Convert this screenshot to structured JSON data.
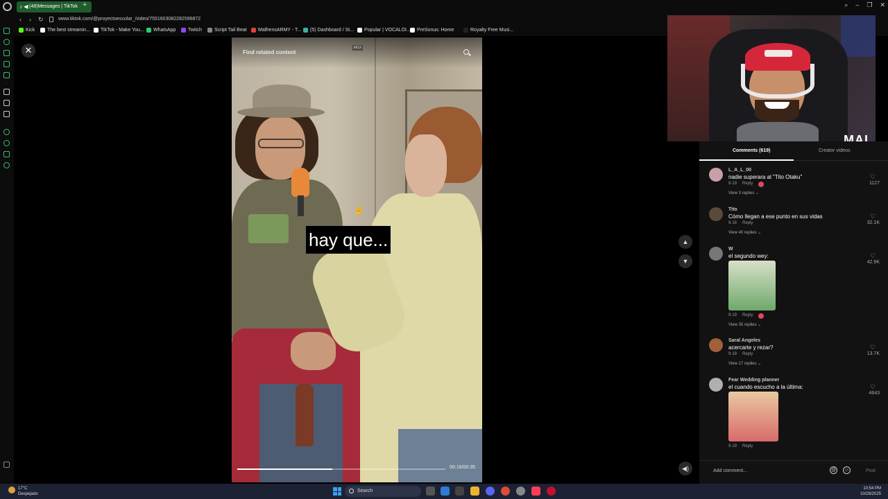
{
  "browser": {
    "tab_title": "(48)Messages | TikTok",
    "url": "www.tiktok.com/@proyectoescolar_/video/7551603082282596872",
    "bookmarks": [
      {
        "label": "Kick",
        "color": "#53fc18"
      },
      {
        "label": "The best streamin...",
        "color": "#ffffff"
      },
      {
        "label": "TikTok - Make You...",
        "color": "#ffffff"
      },
      {
        "label": "WhatsApp",
        "color": "#25d366"
      },
      {
        "label": "Twitch",
        "color": "#9146ff"
      },
      {
        "label": "Script Tail Beat",
        "color": "#888888"
      },
      {
        "label": "MalfrensARMY - T...",
        "color": "#e04040"
      },
      {
        "label": "(5) Dashboard / St...",
        "color": "#40b0a0"
      },
      {
        "label": "Popular | VOCALOI...",
        "color": "#ffffff"
      },
      {
        "label": "PreSonus: Home",
        "color": "#ffffff"
      },
      {
        "label": "Royalty Free Musi...",
        "color": "#222222"
      }
    ]
  },
  "video": {
    "find_related": "Find related content",
    "subtitle": "hay que...",
    "timecode": "00:16/00:35",
    "progress": 0.457,
    "watermark": "MGX"
  },
  "webcam": {
    "brand": "MAI"
  },
  "comments_panel": {
    "tab_comments": "Comments (619)",
    "tab_creator": "Creator videos",
    "comments": [
      {
        "user": "L_A_L_00",
        "text": "nadie superara al \"Tito Otaku\"",
        "date": "9-19",
        "reply": "Reply",
        "replies": "View 3 replies",
        "likes": "1127",
        "creator_liked": true,
        "avatar_color": "#c9a0a8"
      },
      {
        "user": "Tito",
        "text": "Cómo llegan a ese punto en sus vidas",
        "date": "9-18",
        "reply": "Reply",
        "replies": "View 40 replies",
        "likes": "32.1K",
        "creator_liked": false,
        "avatar_color": "#5a4a3a"
      },
      {
        "user": "W",
        "text": "el segundo wey:",
        "date": "9-19",
        "reply": "Reply",
        "replies": "View 35 replies",
        "likes": "42.9K",
        "creator_liked": true,
        "avatar_color": "#777777"
      },
      {
        "user": "Saral Angeles",
        "text": "acercarte y rezar?",
        "date": "9-18",
        "reply": "Reply",
        "replies": "View 17 replies",
        "likes": "13.7K",
        "creator_liked": false,
        "avatar_color": "#a0603a"
      },
      {
        "user": "Fear Wedding planner",
        "text": "el cuando escucho a la última:",
        "date": "9-19",
        "reply": "Reply",
        "replies": "",
        "likes": "4643",
        "creator_liked": false,
        "avatar_color": "#b0b0b0"
      }
    ],
    "add_comment_placeholder": "Add comment...",
    "at_symbol": "@",
    "emoji_symbol": "☺",
    "post": "Post"
  },
  "taskbar": {
    "temperature": "17°C",
    "weather": "Despejado",
    "search": "Search",
    "time": "10:54 PM",
    "date": "10/28/2025"
  }
}
